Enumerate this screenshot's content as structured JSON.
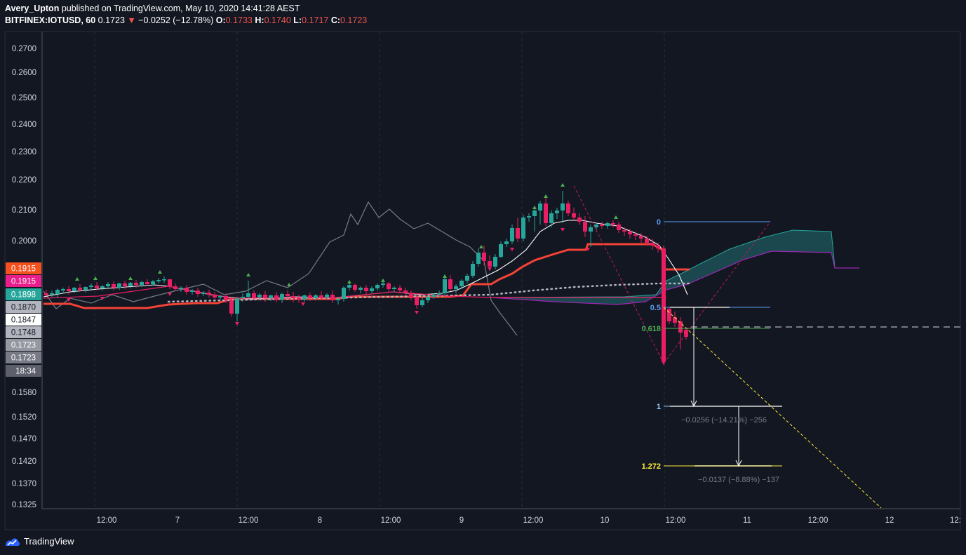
{
  "header": {
    "user": "Avery_Upton",
    "published_text": "published on TradingView.com, May 10, 2020 14:41:28 AEST",
    "symbol": "BITFINEX:IOTUSD, 60",
    "last": "0.1723",
    "arrow": "▼",
    "change": "−0.0252 (−12.78%)",
    "o_label": "O:",
    "o": "0.1733",
    "h_label": "H:",
    "h": "0.1740",
    "l_label": "L:",
    "l": "0.1717",
    "c_label": "C:",
    "c": "0.1723"
  },
  "footer": {
    "brand": "TradingView"
  },
  "colors": {
    "background": "#131722",
    "axis_text": "#d1d4dc",
    "up": "#26a69a",
    "down": "#e91e63",
    "red_line": "#f44336",
    "gray_line": "#787b86",
    "fib_blue": "#5b9cf6",
    "fib_green": "#4caf50",
    "fib_yellow": "#ffeb3b",
    "cloud": "#1d5a5e"
  },
  "chart_data": {
    "type": "candlestick",
    "symbol": "BITFINEX:IOTUSD",
    "interval": "60",
    "ylim": [
      0.1325,
      0.274
    ],
    "y_ticks": [
      "0.2700",
      "0.2600",
      "0.2500",
      "0.2400",
      "0.2300",
      "0.2200",
      "0.2100",
      "0.2000",
      "0.1580",
      "0.1520",
      "0.1470",
      "0.1420",
      "0.1370",
      "0.1325"
    ],
    "x_ticks": [
      "12:00",
      "7",
      "12:00",
      "8",
      "12:00",
      "9",
      "12:00",
      "10",
      "12:00",
      "11",
      "12:00",
      "12",
      "12:"
    ],
    "price_tags": [
      {
        "value": "0.1915",
        "color": "#f4511e"
      },
      {
        "value": "0.1915",
        "color": "#e91e8c"
      },
      {
        "value": "0.1898",
        "color": "#26a69a"
      },
      {
        "value": "0.1870",
        "color": "#b2b5be"
      },
      {
        "value": "0.1847",
        "color": "#ffffff"
      },
      {
        "value": "0.1748",
        "color": "#b2b5be"
      },
      {
        "value": "0.1723",
        "color": "#9598a1"
      },
      {
        "value": "0.1723",
        "color": "#787b86"
      },
      {
        "value": "18:34",
        "color": "#5d606b"
      }
    ],
    "fib_levels": [
      {
        "label": "0",
        "color": "#5b9cf6"
      },
      {
        "label": "0.5",
        "color": "#5b9cf6"
      },
      {
        "label": "0.618",
        "color": "#4caf50"
      },
      {
        "label": "1",
        "color": "#90caf9"
      },
      {
        "label": "1.272",
        "color": "#ffeb3b"
      }
    ],
    "measurements": [
      {
        "text": "−0.0256 (−14.21%) −256"
      },
      {
        "text": "−0.0137 (−8.88%) −137"
      }
    ]
  }
}
